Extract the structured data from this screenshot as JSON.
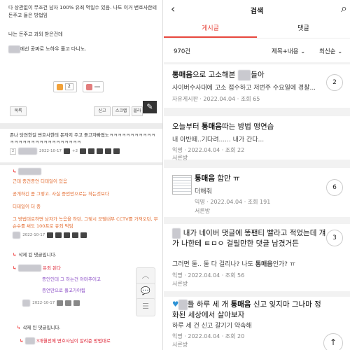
{
  "left": {
    "body": {
      "line1": "다 상관없이 무조건 남자 100% 유죄 먹일수 있음. 나도 이거 변호사한테 돈주고 들은 방법임",
      "line2": "나는 돈주고 과외 받은건데",
      "line3_tail": "에선 공짜로 노하우 풀고 다니노."
    },
    "votes": {
      "up_count": "2",
      "down_count": ""
    },
    "buttons": {
      "list": "목록",
      "report": "신고",
      "scrap": "스크랩",
      "more": "블라"
    },
    "comment1": {
      "text": "존나 당연한걸 변호사한테 돈까지 주고 듣고자빠졌노ㅋㅋㅋㅋㅋㅋㅋㅋㅋㅋㅋㅋㅋㅋㅋㅋㅋㅋㅋㅋㅋㅋㅋㅋㅋㅋㅋㅋ",
      "num": "2",
      "date": "2022-10-17",
      "plus": "+2"
    },
    "reply1": {
      "lines": [
        "근데 증건증언 디테일이 있음",
        "공개하긴 좀 그렇고. 사실 증언만으로는 하는것보다",
        "디테일이 더 중",
        "그 방법대로하면 남자가 녹음을 하던, 그렇시 모텔내부 CCTV를 가져오던, 무슨수를 써도 100프로 유죄 먹임"
      ],
      "date": "2022-10-17"
    },
    "deleted1": "삭제 된 댓글입니다.",
    "reply2": {
      "lines": [
        "유죄 된다",
        "증인인데 그 하는건 아마추어고",
        "증언만으로 풀고가야됨"
      ],
      "date": "2022-10-17"
    },
    "deleted2": "삭제 된 댓글입니다.",
    "reply3": {
      "line": "3개월전에 변호사님이 알려준 방법대로"
    }
  },
  "right": {
    "header": {
      "title": "검색"
    },
    "tabs": [
      "게시글",
      "댓글"
    ],
    "count": "970건",
    "sort1": "제목+내용 ⌄",
    "sort2": "최신순 ⌄",
    "posts": [
      {
        "title_pre": "",
        "title_kw": "통매음",
        "title_post": "으로 고소해본 ",
        "title_tail": "들아",
        "body": "사이버수사대에 고소 접수하고 저번주 수요일에 경찰...",
        "meta": "",
        "board": "자유게시판 · 2022.04.04 · 조회 65",
        "comments": "2"
      },
      {
        "title_pre": "오늘부터 ",
        "title_kw": "통매음",
        "title_post": "따는 방법 맹연습",
        "title_tail": "",
        "body": "내 아반떼..기다려...... 내가 간다...",
        "meta": "익명 · 2022.04.04 · 조회 22",
        "board": "서른방",
        "comments": ""
      },
      {
        "title_pre": "",
        "title_kw": "통매음",
        "title_post": " 함만 ㅠ",
        "title_tail": "",
        "body": "더해줘",
        "meta": "익명 · 2022.04.04 · 조회 191",
        "board": "서른방",
        "comments": "6"
      },
      {
        "title_pre": "",
        "title_kw": "",
        "title_post": "내가 네이버 댓글에 똥팬티 빨라고 적었는데 걔가 나한테 ㅌㅁㅇ 걸릴만한 댓글 남겼거든",
        "title_tail": "",
        "body_pre": "그러면 둘.. 둘 다 걸리나? 나도 ",
        "body_kw": "통매음",
        "body_post": "인가? ㅠ",
        "meta": "익명 · 2022.04.04 · 조회 56",
        "board": "서른방",
        "comments": "3"
      },
      {
        "title_pre": "",
        "title_kw": "통매음",
        "title_post": "",
        "title_a": "들 하루 세 개 ",
        "title_b": " 신고 잊지마 그나마 정화된 세상에서 살아보자",
        "body": "하루 세 건 신고 갈기기 약속해",
        "meta": "익명 · 2022.04.04 · 조회 20",
        "board": "서른방",
        "comments": ""
      }
    ]
  }
}
